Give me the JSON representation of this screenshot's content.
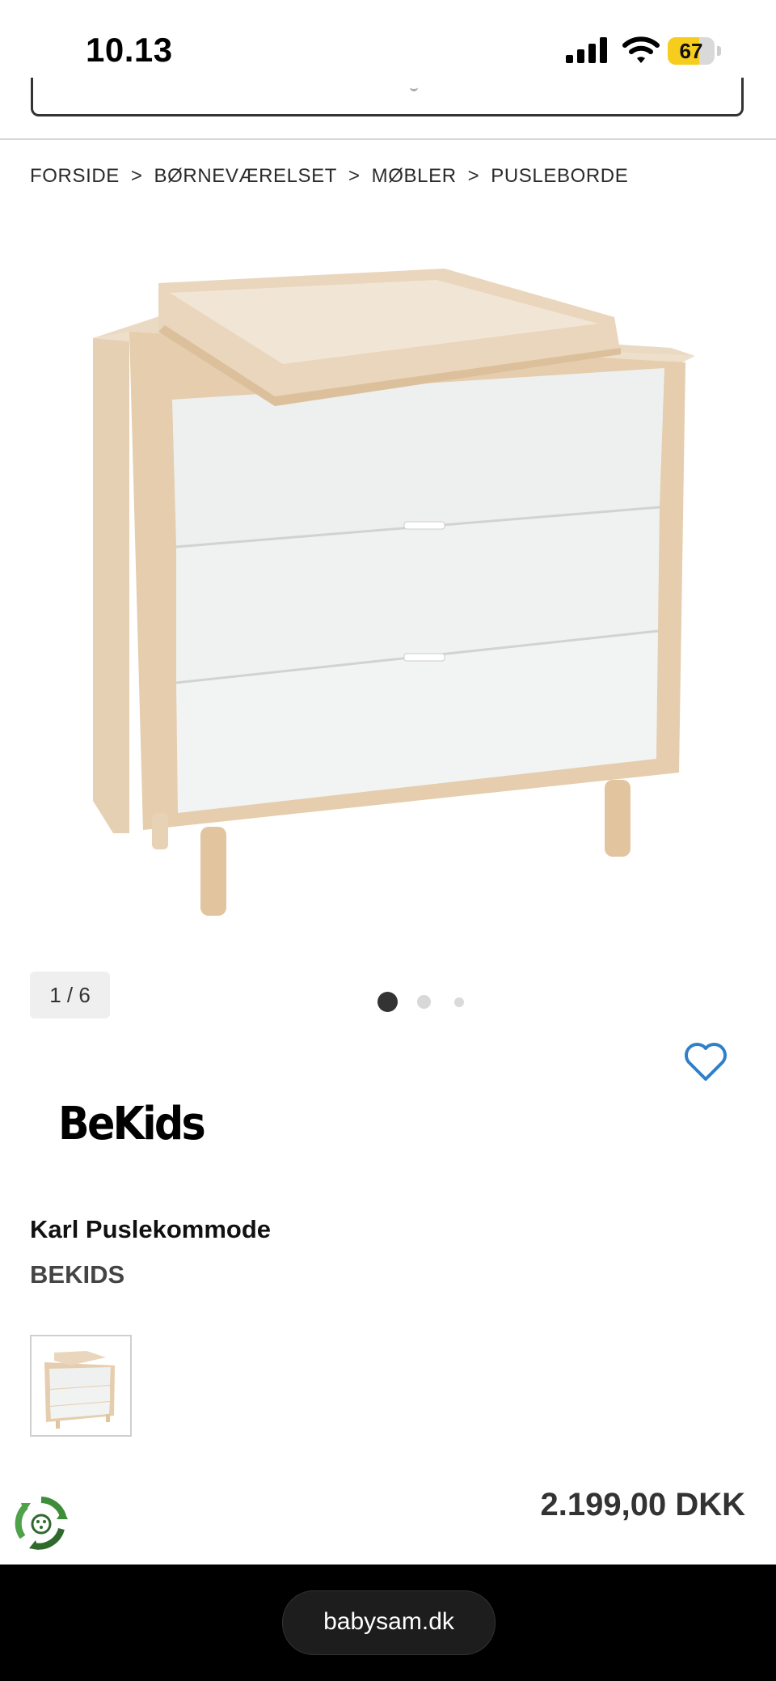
{
  "status_bar": {
    "time": "10.13",
    "battery_level": "67",
    "battery_fraction": 0.67
  },
  "breadcrumb": {
    "items": [
      "FORSIDE",
      "BØRNEVÆRELSET",
      "MØBLER",
      "PUSLEBORDE"
    ],
    "separator": ">"
  },
  "gallery": {
    "counter": "1 / 6",
    "current": 1,
    "total_dots": 3
  },
  "brand_logo_text": "BeKids",
  "product": {
    "title": "Karl Puslekommode",
    "brand": "BEKIDS",
    "price": "2.199,00 DKK"
  },
  "browser": {
    "url": "babysam.dk"
  },
  "colors": {
    "wood": "#e8d3b8",
    "drawer": "#f1f3f2",
    "heart": "#2f80c9",
    "eco_green": "#3f8d3a",
    "price": "#333333"
  },
  "icons": [
    "signal-icon",
    "wifi-icon",
    "battery-icon",
    "heart-icon",
    "eco-icon"
  ]
}
